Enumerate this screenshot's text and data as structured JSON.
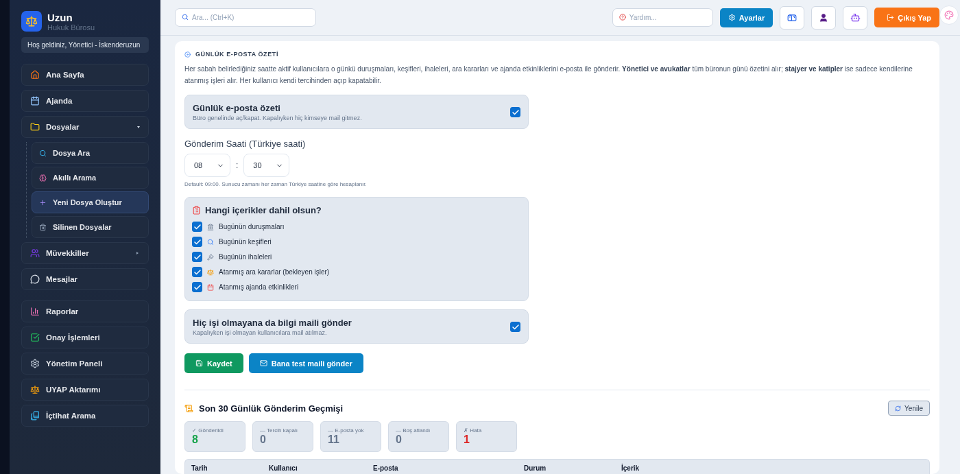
{
  "brand": {
    "name": "Uzun",
    "subtitle": "Hukuk Bürosu",
    "welcome": "Hoş geldiniz, Yönetici - İskenderuzun"
  },
  "sidebar": {
    "groups": [
      [
        {
          "label": "Ana Sayfa",
          "kind": "item",
          "selected": false
        },
        {
          "label": "Ajanda",
          "kind": "item",
          "selected": false
        },
        {
          "label": "Dosyalar",
          "kind": "folder",
          "selected": false,
          "expanded": true,
          "children": [
            {
              "label": "Dosya Ara",
              "selected": false
            },
            {
              "label": "Akıllı Arama",
              "selected": false
            },
            {
              "label": "Yeni Dosya Oluştur",
              "selected": true
            },
            {
              "label": "Silinen Dosyalar",
              "selected": false
            }
          ]
        },
        {
          "label": "Müvekkiller",
          "kind": "folder",
          "selected": false,
          "expanded": false
        },
        {
          "label": "Mesajlar",
          "kind": "item",
          "selected": false
        }
      ],
      [
        {
          "label": "Raporlar",
          "kind": "item",
          "selected": false
        },
        {
          "label": "Onay İşlemleri",
          "kind": "item",
          "selected": false
        },
        {
          "label": "Yönetim Paneli",
          "kind": "item",
          "selected": false
        },
        {
          "label": "UYAP Aktarımı",
          "kind": "item",
          "selected": false
        },
        {
          "label": "İçtihat Arama",
          "kind": "item",
          "selected": false
        }
      ]
    ]
  },
  "topbar": {
    "search": {
      "placeholder": "Ara... (Ctrl+K)"
    },
    "help": {
      "placeholder": "Yardım..."
    },
    "settings_button": "Ayarlar",
    "logout_button": "Çıkış Yap"
  },
  "digest": {
    "section_title": "GÜNLÜK E-POSTA ÖZETİ",
    "description": "Her sabah belirlediğiniz saatte aktif kullanıcılara o günkü duruşmaları, keşifleri, ihaleleri, ara kararları ve ajanda etkinliklerini e-posta ile gönderir. **Yönetici ve avukatlar** tüm büronun günü özetini alır; **stajyer ve katipler** ise sadece kendilerine atanmış işleri alır. Her kullanıcı kendi tercihinden açıp kapatabilir.",
    "enable": {
      "title": "Günlük e-posta özeti",
      "hint": "Büro genelinde aç/kapat. Kapalıyken hiç kimseye mail gitmez.",
      "checked": true
    },
    "time": {
      "label": "Gönderim Saati (Türkiye saati)",
      "hour": "08",
      "separator": ":",
      "minute": "30",
      "hint": "Default: 09:00. Sunucu zamanı her zaman Türkiye saatine göre hesaplanır."
    },
    "contents": {
      "title": "Hangi içerikler dahil olsun?",
      "items": [
        {
          "label": "Bugünün duruşmaları",
          "checked": true
        },
        {
          "label": "Bugünün keşifleri",
          "checked": true
        },
        {
          "label": "Bugünün ihaleleri",
          "checked": true
        },
        {
          "label": "Atanmış ara kararlar (bekleyen işler)",
          "checked": true
        },
        {
          "label": "Atanmış ajanda etkinlikleri",
          "checked": true
        }
      ]
    },
    "send_empty": {
      "title": "Hiç işi olmayana da bilgi maili gönder",
      "hint": "Kapalıyken işi olmayan kullanıcılara mail atılmaz.",
      "checked": true
    },
    "save_button": "Kaydet",
    "test_button": "Bana test maili gönder"
  },
  "history": {
    "title": "Son 30 Günlük Gönderim Geçmişi",
    "refresh_button": "Yenile",
    "stats": [
      {
        "label": "✓ Gönderildi",
        "value": "8",
        "color": "#16a34a"
      },
      {
        "label": "— Tercih kapalı",
        "value": "0",
        "color": "#64748b"
      },
      {
        "label": "— E-posta yok",
        "value": "11",
        "color": "#64748b"
      },
      {
        "label": "— Boş atlandı",
        "value": "0",
        "color": "#64748b"
      },
      {
        "label": "✗ Hata",
        "value": "1",
        "color": "#dc2626"
      }
    ],
    "table": {
      "columns": [
        "Tarih",
        "Kullanıcı",
        "E-posta",
        "Durum",
        "İçerik"
      ]
    }
  }
}
